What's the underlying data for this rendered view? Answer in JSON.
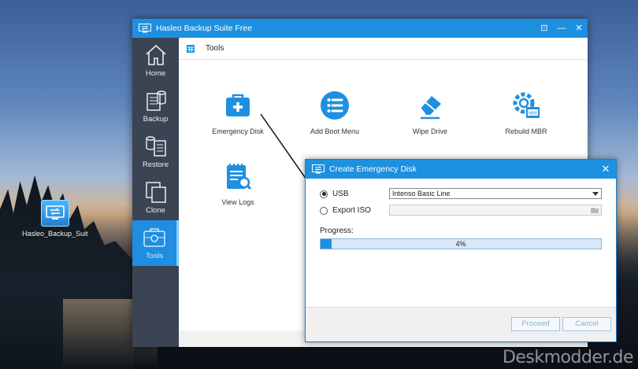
{
  "desktop": {
    "icon_label": "Hasleo_Backup_Suite",
    "watermark": "Deskmodder.de"
  },
  "window": {
    "title": "Hasleo Backup Suite Free",
    "controls": {
      "restore": "⊡",
      "minimize": "—",
      "close": "✕"
    }
  },
  "sidebar": {
    "items": [
      {
        "label": "Home",
        "icon": "home-icon"
      },
      {
        "label": "Backup",
        "icon": "backup-icon"
      },
      {
        "label": "Restore",
        "icon": "restore-icon"
      },
      {
        "label": "Clone",
        "icon": "clone-icon"
      },
      {
        "label": "Tools",
        "icon": "tools-icon",
        "active": true
      }
    ]
  },
  "breadcrumb": {
    "label": "Tools"
  },
  "tools": [
    {
      "label": "Emergency Disk",
      "icon": "first-aid-icon"
    },
    {
      "label": "Add Boot Menu",
      "icon": "list-icon"
    },
    {
      "label": "Wipe Drive",
      "icon": "eraser-icon"
    },
    {
      "label": "Rebuild MBR",
      "icon": "gear-mbr-icon"
    },
    {
      "label": "View Logs",
      "icon": "log-search-icon"
    }
  ],
  "dialog": {
    "title": "Create Emergency Disk",
    "close": "✕",
    "usb_label": "USB",
    "usb_selected": true,
    "usb_device": "Intenso Basic Line",
    "iso_label": "Export ISO",
    "iso_path": "",
    "progress_label": "Progress:",
    "progress_percent": 4,
    "progress_text": "4%",
    "proceed_label": "Proceed",
    "cancel_label": "Cancel"
  },
  "colors": {
    "accent": "#1e90e0",
    "sidebar_bg": "#3b4452",
    "sidebar_active": "#1f8de0"
  }
}
